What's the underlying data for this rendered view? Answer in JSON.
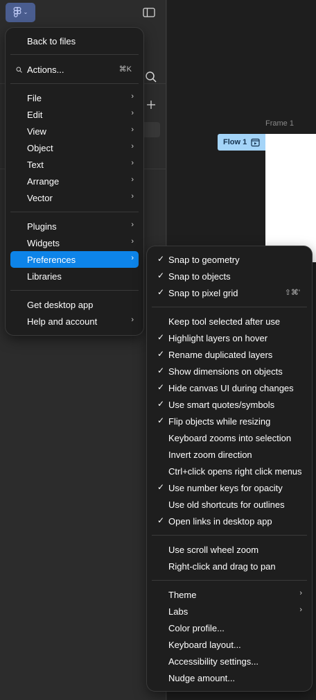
{
  "main_menu": {
    "back": "Back to files",
    "actions": "Actions...",
    "actions_shortcut": "⌘K",
    "file": "File",
    "edit": "Edit",
    "view": "View",
    "object": "Object",
    "text": "Text",
    "arrange": "Arrange",
    "vector": "Vector",
    "plugins": "Plugins",
    "widgets": "Widgets",
    "preferences": "Preferences",
    "libraries": "Libraries",
    "desktop": "Get desktop app",
    "help": "Help and account"
  },
  "canvas": {
    "frame_label": "Frame 1",
    "flow_label": "Flow 1"
  },
  "preferences": {
    "snap_geometry": "Snap to geometry",
    "snap_objects": "Snap to objects",
    "snap_pixel": "Snap to pixel grid",
    "snap_pixel_shortcut": "⇧⌘'",
    "keep_tool": "Keep tool selected after use",
    "highlight_layers": "Highlight layers on hover",
    "rename_duplicated": "Rename duplicated layers",
    "show_dimensions": "Show dimensions on objects",
    "hide_canvas_ui": "Hide canvas UI during changes",
    "smart_quotes": "Use smart quotes/symbols",
    "flip_objects": "Flip objects while resizing",
    "keyboard_zooms": "Keyboard zooms into selection",
    "invert_zoom": "Invert zoom direction",
    "ctrl_click": "Ctrl+click opens right click menus",
    "number_keys": "Use number keys for opacity",
    "old_shortcuts": "Use old shortcuts for outlines",
    "open_links": "Open links in desktop app",
    "scroll_zoom": "Use scroll wheel zoom",
    "right_click_pan": "Right-click and drag to pan",
    "theme": "Theme",
    "labs": "Labs",
    "color_profile": "Color profile...",
    "keyboard_layout": "Keyboard layout...",
    "accessibility": "Accessibility settings...",
    "nudge": "Nudge amount..."
  },
  "checked": {
    "snap_geometry": true,
    "snap_objects": true,
    "snap_pixel": true,
    "keep_tool": false,
    "highlight_layers": true,
    "rename_duplicated": true,
    "show_dimensions": true,
    "hide_canvas_ui": true,
    "smart_quotes": true,
    "flip_objects": true,
    "keyboard_zooms": false,
    "invert_zoom": false,
    "ctrl_click": false,
    "number_keys": true,
    "old_shortcuts": false,
    "open_links": true,
    "scroll_zoom": false,
    "right_click_pan": false
  },
  "glyphs": {
    "check": "✓",
    "arrow": "›"
  },
  "colors": {
    "menu_bg": "#1e1e1e",
    "highlight": "#0d84e9",
    "flow_badge": "#a4d4f8",
    "main_menu_button": "#4a5d8f"
  }
}
